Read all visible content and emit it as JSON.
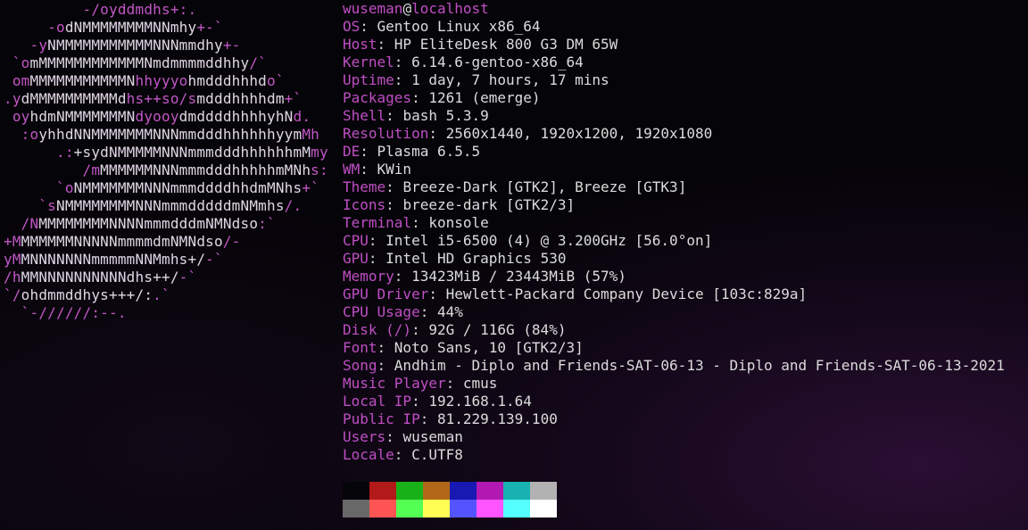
{
  "header": {
    "user": "wuseman",
    "at": "@",
    "host": "localhost",
    "separator": "---------------------"
  },
  "logo": [
    [
      {
        "c": "m",
        "t": "         -/oyddmdhs+:."
      }
    ],
    [
      {
        "c": "m",
        "t": "     -o"
      },
      {
        "c": "w",
        "t": "dNMMMMMMMMNNmhy"
      },
      {
        "c": "m",
        "t": "+-`"
      }
    ],
    [
      {
        "c": "m",
        "t": "   -y"
      },
      {
        "c": "w",
        "t": "NMMMMMMMMMMMNNNmmdhy"
      },
      {
        "c": "m",
        "t": "+-"
      }
    ],
    [
      {
        "c": "m",
        "t": " `o"
      },
      {
        "c": "w",
        "t": "mMMMMMMMMMMMMNmdmmmmddhhy"
      },
      {
        "c": "m",
        "t": "/`"
      }
    ],
    [
      {
        "c": "m",
        "t": " om"
      },
      {
        "c": "w",
        "t": "MMMMMMMMMMMN"
      },
      {
        "c": "m",
        "t": "hhyyyo"
      },
      {
        "c": "w",
        "t": "hmdddhhhd"
      },
      {
        "c": "m",
        "t": "o`"
      }
    ],
    [
      {
        "c": "m",
        "t": ".y"
      },
      {
        "c": "w",
        "t": "dMMMMMMMMMMd"
      },
      {
        "c": "m",
        "t": "hs++so/s"
      },
      {
        "c": "w",
        "t": "mdddhhhhdm"
      },
      {
        "c": "m",
        "t": "+`"
      }
    ],
    [
      {
        "c": "m",
        "t": " oy"
      },
      {
        "c": "w",
        "t": "hdmNMMMMMMMN"
      },
      {
        "c": "m",
        "t": "dyooy"
      },
      {
        "c": "w",
        "t": "dmddddhhhhyhN"
      },
      {
        "c": "m",
        "t": "d."
      }
    ],
    [
      {
        "c": "m",
        "t": "  :o"
      },
      {
        "c": "w",
        "t": "yhhdNNMMMMMMMNNNmmdddhhhhhhyym"
      },
      {
        "c": "m",
        "t": "Mh"
      }
    ],
    [
      {
        "c": "m",
        "t": "      .:"
      },
      {
        "c": "w",
        "t": "+sydNMMMMMNNNmmmdddhhhhhhmM"
      },
      {
        "c": "m",
        "t": "my"
      }
    ],
    [
      {
        "c": "m",
        "t": "         /m"
      },
      {
        "c": "w",
        "t": "MMMMMMNNNmmmdddhhhhhmMNh"
      },
      {
        "c": "m",
        "t": "s:"
      }
    ],
    [
      {
        "c": "m",
        "t": "      `o"
      },
      {
        "c": "w",
        "t": "NMMMMMMMNNNmmmddddhhdmMNhs"
      },
      {
        "c": "m",
        "t": "+`"
      }
    ],
    [
      {
        "c": "m",
        "t": "    `s"
      },
      {
        "c": "w",
        "t": "NMMMMMMMMNNNmmmdddddmNMmhs"
      },
      {
        "c": "m",
        "t": "/."
      }
    ],
    [
      {
        "c": "m",
        "t": "  /N"
      },
      {
        "c": "w",
        "t": "MMMMMMMMNNNNmmmdddmNMNdso"
      },
      {
        "c": "m",
        "t": ":`"
      }
    ],
    [
      {
        "c": "m",
        "t": "+M"
      },
      {
        "c": "w",
        "t": "MMMMMMNNNNNmmmmdmNMNdso"
      },
      {
        "c": "m",
        "t": "/-"
      }
    ],
    [
      {
        "c": "m",
        "t": "yM"
      },
      {
        "c": "w",
        "t": "MNNNNNNNmmmmmNNMmhs+/"
      },
      {
        "c": "m",
        "t": "-`"
      }
    ],
    [
      {
        "c": "m",
        "t": "/h"
      },
      {
        "c": "w",
        "t": "MMNNNNNNNNNNdhs++/"
      },
      {
        "c": "m",
        "t": "-`"
      }
    ],
    [
      {
        "c": "m",
        "t": "`/"
      },
      {
        "c": "w",
        "t": "ohdmmddhys+++/:"
      },
      {
        "c": "m",
        "t": ".`"
      }
    ],
    [
      {
        "c": "m",
        "t": "  `-//////:--."
      }
    ]
  ],
  "info": [
    {
      "key": "OS",
      "value": "Gentoo Linux x86_64"
    },
    {
      "key": "Host",
      "value": "HP EliteDesk 800 G3 DM 65W"
    },
    {
      "key": "Kernel",
      "value": "6.14.6-gentoo-x86_64"
    },
    {
      "key": "Uptime",
      "value": "1 day, 7 hours, 17 mins"
    },
    {
      "key": "Packages",
      "value": "1261 (emerge)"
    },
    {
      "key": "Shell",
      "value": "bash 5.3.9"
    },
    {
      "key": "Resolution",
      "value": "2560x1440, 1920x1200, 1920x1080"
    },
    {
      "key": "DE",
      "value": "Plasma 6.5.5"
    },
    {
      "key": "WM",
      "value": "KWin"
    },
    {
      "key": "Theme",
      "value": "Breeze-Dark [GTK2], Breeze [GTK3]"
    },
    {
      "key": "Icons",
      "value": "breeze-dark [GTK2/3]"
    },
    {
      "key": "Terminal",
      "value": "konsole"
    },
    {
      "key": "CPU",
      "value": "Intel i5-6500 (4) @ 3.200GHz [56.0°on]"
    },
    {
      "key": "GPU",
      "value": "Intel HD Graphics 530"
    },
    {
      "key": "Memory",
      "value": "13423MiB / 23443MiB (57%)"
    },
    {
      "key": "GPU Driver",
      "value": "Hewlett-Packard Company Device [103c:829a]"
    },
    {
      "key": "CPU Usage",
      "value": "44%"
    },
    {
      "key": "Disk (/)",
      "value": "92G / 116G (84%)"
    },
    {
      "key": "Font",
      "value": "Noto Sans, 10 [GTK2/3]"
    },
    {
      "key": "Song",
      "value": "Andhim - Diplo and Friends-SAT-06-13 - Diplo and Friends-SAT-06-13-2021"
    },
    {
      "key": "Music Player",
      "value": "cmus"
    },
    {
      "key": "Local IP",
      "value": "192.168.1.64"
    },
    {
      "key": "Public IP",
      "value": "81.229.139.100"
    },
    {
      "key": "Users",
      "value": "wuseman"
    },
    {
      "key": "Locale",
      "value": "C.UTF8"
    }
  ],
  "palette": {
    "normal": [
      "#050408",
      "#b21a1a",
      "#18b218",
      "#b26818",
      "#1818b2",
      "#b218b2",
      "#18b2b2",
      "#b2b2b2"
    ],
    "bright": [
      "#686868",
      "#ff5454",
      "#54ff54",
      "#ffff54",
      "#5454ff",
      "#ff54ff",
      "#54ffff",
      "#ffffff"
    ]
  }
}
